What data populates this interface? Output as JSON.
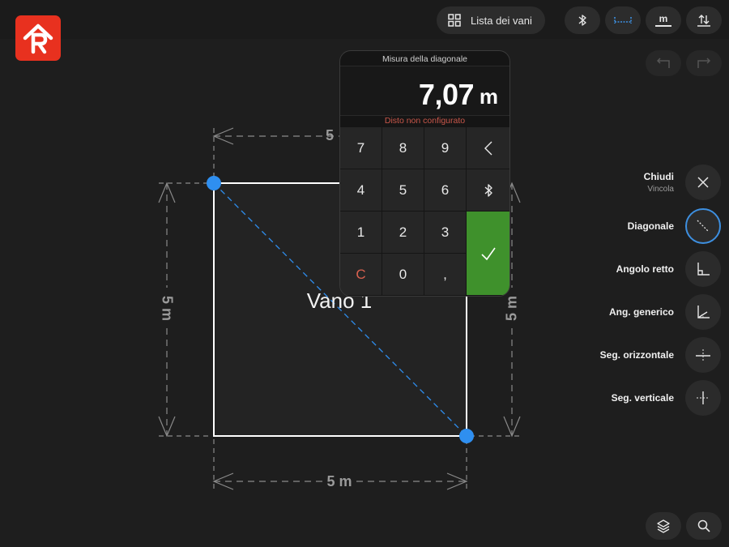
{
  "header": {
    "rooms_button_label": "Lista dei vani",
    "icons": [
      "app-logo",
      "grid-icon",
      "bluetooth-icon",
      "distance-mode-icon",
      "unit-icon",
      "sort-icon"
    ],
    "unit_label": "m"
  },
  "history": {
    "icons": [
      "undo-icon",
      "redo-icon"
    ]
  },
  "canvas": {
    "room_name": "Vano 1",
    "dim_top": "5",
    "dim_bottom": "5 m",
    "dim_left": "5 m",
    "dim_right": "5 m",
    "colors": {
      "accent": "#2f8ff0",
      "wall": "#ffffff",
      "room_fill": "#232323",
      "dimension": "#8a8a8a"
    }
  },
  "keypad": {
    "title": "Misura della diagonale",
    "value": "7,07",
    "unit": "m",
    "status": "Disto non configurato",
    "keys": [
      "7",
      "8",
      "9",
      "4",
      "5",
      "6",
      "1",
      "2",
      "3",
      "C",
      "0",
      ","
    ],
    "icons": [
      "backspace-icon",
      "bluetooth-icon",
      "confirm-check-icon"
    ],
    "colors": {
      "confirm": "#3f912c",
      "status": "#c9574a"
    }
  },
  "tools": [
    {
      "label": "Chiudi",
      "sublabel": "Vincola",
      "icon": "close-icon"
    },
    {
      "label": "Diagonale",
      "icon": "diagonal-icon",
      "active": true
    },
    {
      "label": "Angolo retto",
      "icon": "right-angle-icon"
    },
    {
      "label": "Ang. generico",
      "icon": "generic-angle-icon"
    },
    {
      "label": "Seg. orizzontale",
      "icon": "horizontal-segment-icon"
    },
    {
      "label": "Seg. verticale",
      "icon": "vertical-segment-icon"
    }
  ],
  "footer": {
    "icons": [
      "layers-icon",
      "search-icon"
    ]
  }
}
